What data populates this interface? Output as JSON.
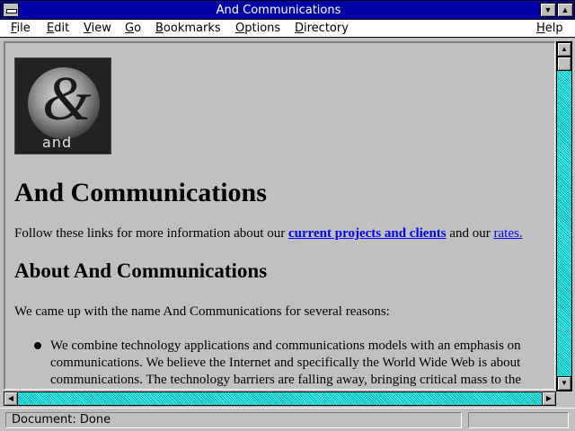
{
  "window": {
    "title": "And Communications"
  },
  "menubar": {
    "items": [
      {
        "first": "F",
        "rest": "ile"
      },
      {
        "first": "E",
        "rest": "dit"
      },
      {
        "first": "V",
        "rest": "iew"
      },
      {
        "first": "G",
        "rest": "o"
      },
      {
        "first": "B",
        "rest": "ookmarks"
      },
      {
        "first": "O",
        "rest": "ptions"
      },
      {
        "first": "D",
        "rest": "irectory"
      },
      {
        "first": "H",
        "rest": "elp"
      }
    ]
  },
  "content": {
    "logo_word": "and",
    "heading": "And Communications",
    "intro_before": "Follow these links for more information about our ",
    "link_projects": "current projects and clients",
    "intro_middle": " and our ",
    "link_rates": "rates.",
    "about_heading": "About And Communications",
    "about_para": "We came up with the name And Communications for several reasons:",
    "reasons": [
      "We combine technology applications and communications models with an emphasis on communications. We believe the Internet and specifically the World Wide Web is about communications. The technology barriers are falling away, bringing critical mass to the"
    ]
  },
  "status": {
    "text": "Document: Done"
  }
}
